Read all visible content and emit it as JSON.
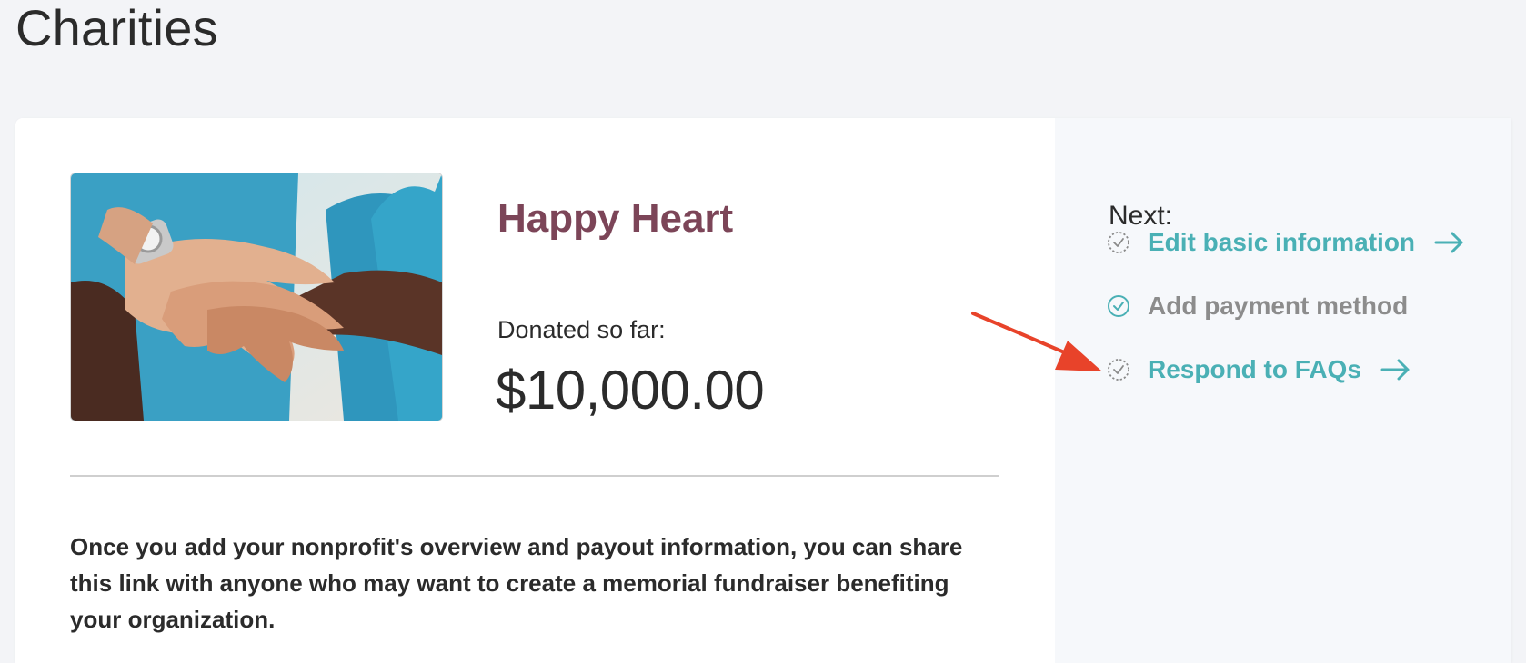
{
  "page": {
    "title": "Charities"
  },
  "charity": {
    "name": "Happy Heart",
    "donated_label": "Donated so far:",
    "donated_amount": "$10,000.00",
    "photo_icon": "charity-photo-hands",
    "description": "Once you add your nonprofit's overview and payout information, you can share this link with anyone who may want to create a memorial fundraiser benefiting your organization."
  },
  "next_panel": {
    "heading": "Next:",
    "steps": [
      {
        "label": "Edit basic information",
        "status": "pending",
        "icon": "dashed-check-circle-icon",
        "arrow": "arrow-right-icon"
      },
      {
        "label": "Add payment method",
        "status": "done",
        "icon": "check-circle-icon"
      },
      {
        "label": "Respond to FAQs",
        "status": "pending",
        "icon": "dashed-check-circle-icon",
        "arrow": "arrow-right-icon"
      }
    ]
  },
  "colors": {
    "charity_name": "#7c4558",
    "link_teal": "#4ab0b5",
    "done_gray": "#8c8c8c",
    "annotation_red": "#e8432a",
    "side_panel_bg": "#f6f8fb",
    "page_bg": "#f3f4f7"
  }
}
